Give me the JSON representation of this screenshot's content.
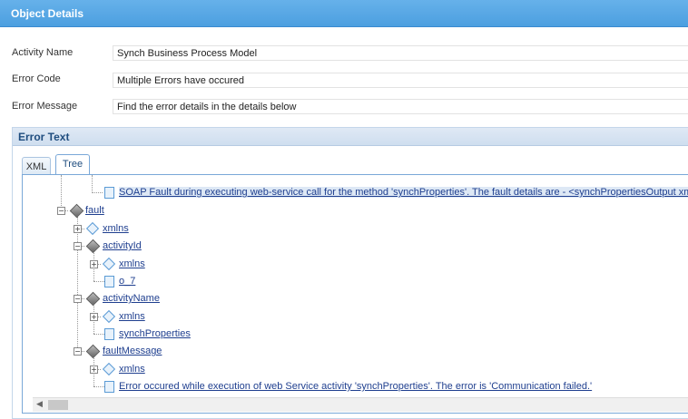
{
  "window": {
    "title": "Object Details"
  },
  "fields": [
    {
      "label": "Activity Name",
      "value": "Synch Business Process Model"
    },
    {
      "label": "Error Code",
      "value": "Multiple Errors have occured"
    },
    {
      "label": "Error Message",
      "value": "Find the error details in the details below"
    }
  ],
  "error_text": {
    "header": "Error Text",
    "tabs": [
      {
        "label": "XML",
        "selected": false
      },
      {
        "label": "Tree",
        "selected": true
      }
    ]
  },
  "tree": {
    "soap_fault": "SOAP Fault during executing web-service call for the method 'synchProperties'. The fault details are - <synchPropertiesOutput xmlns=\"http://sch",
    "fault": "fault",
    "xmlns1": "xmlns",
    "activityId": "activityId",
    "xmlns2": "xmlns",
    "o7": "o_7",
    "activityName": "activityName",
    "xmlns3": "xmlns",
    "synchProperties": "synchProperties",
    "faultMessage": "faultMessage",
    "xmlns4": "xmlns",
    "errorMsg": "Error occured while execution of web Service activity 'synchProperties'. The error is 'Communication failed.'"
  }
}
